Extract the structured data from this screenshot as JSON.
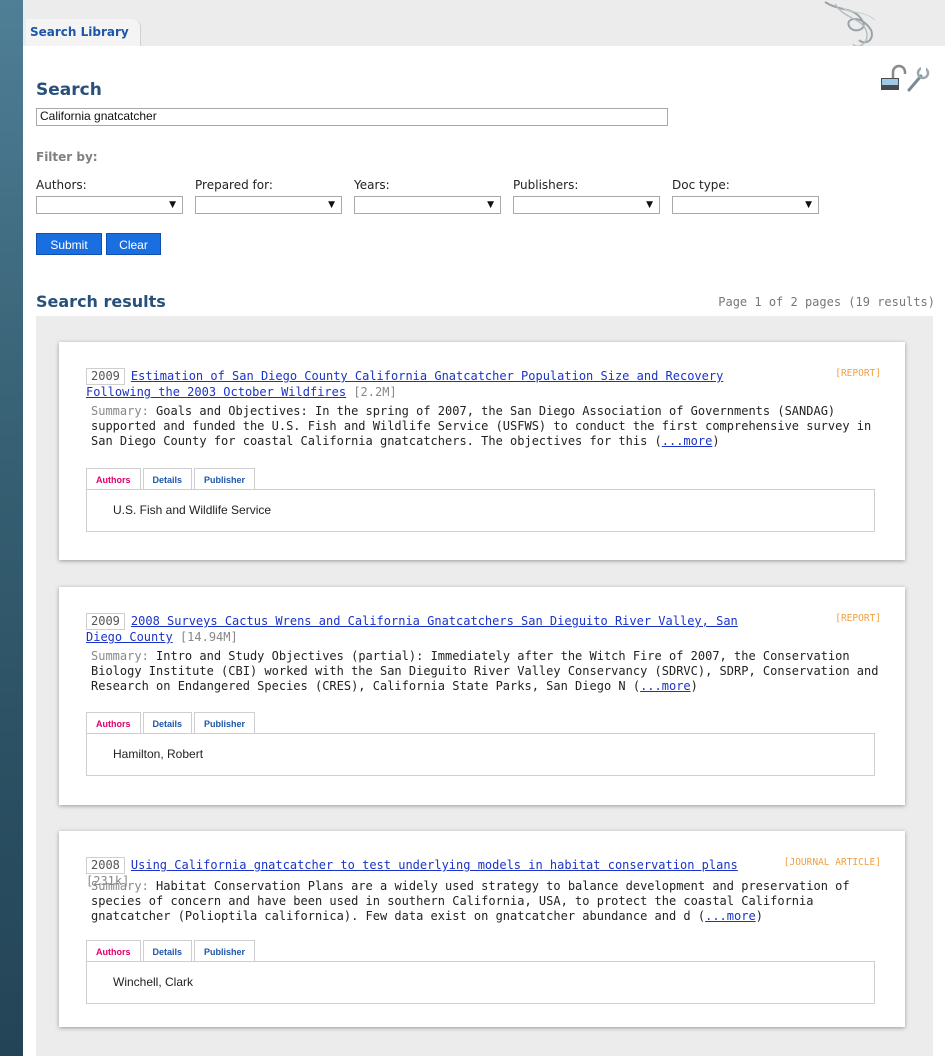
{
  "tabs": {
    "search_library": "Search Library"
  },
  "search": {
    "title": "Search",
    "query": "California gnatcatcher"
  },
  "filters": {
    "label": "Filter by:",
    "fields": [
      {
        "label": "Authors:",
        "value": ""
      },
      {
        "label": "Prepared for:",
        "value": ""
      },
      {
        "label": "Years:",
        "value": ""
      },
      {
        "label": "Publishers:",
        "value": ""
      },
      {
        "label": "Doc type:",
        "value": ""
      }
    ]
  },
  "buttons": {
    "submit": "Submit",
    "clear": "Clear"
  },
  "results": {
    "title": "Search results",
    "page_info": "Page 1 of 2 pages (19 results)",
    "items": [
      {
        "year": "2009",
        "title": "Estimation of San Diego County California Gnatcatcher Population Size and Recovery Following the 2003 October Wildfires",
        "size": "[2.2M]",
        "type": "[REPORT]",
        "summary_label": "Summary:",
        "summary": "Goals and Objectives: In the spring of 2007, the San Diego Association of Governments (SANDAG) supported and funded the U.S. Fish and Wildlife Service (USFWS) to conduct the first comprehensive survey in San Diego County for coastal California gnatcatchers. The objectives for this",
        "more": "...more",
        "tabs": [
          "Authors",
          "Details",
          "Publisher"
        ],
        "author": "U.S. Fish and Wildlife Service"
      },
      {
        "year": "2009",
        "title": "2008 Surveys Cactus Wrens and California Gnatcatchers San Dieguito River Valley, San Diego County",
        "size": "[14.94M]",
        "type": "[REPORT]",
        "summary_label": "Summary:",
        "summary": "Intro and Study Objectives (partial): Immediately after the Witch Fire of 2007, the Conservation Biology Institute (CBI) worked with the San Dieguito River Valley Conservancy (SDRVC), SDRP, Conservation and Research on Endangered Species (CRES), California State Parks, San Diego N",
        "more": "...more",
        "tabs": [
          "Authors",
          "Details",
          "Publisher"
        ],
        "author": "Hamilton, Robert"
      },
      {
        "year": "2008",
        "title": "Using California gnatcatcher to test underlying models in habitat conservation plans",
        "size": "[231k]",
        "type": "[JOURNAL ARTICLE]",
        "summary_label": "Summary:",
        "summary": "Habitat Conservation Plans are a widely used strategy to balance development and preservation of species of concern and have been used in southern California, USA, to protect the coastal California gnatcatcher (Polioptila californica). Few data exist on gnatcatcher abundance and d",
        "more": "...more",
        "tabs": [
          "Authors",
          "Details",
          "Publisher"
        ],
        "author": "Winchell, Clark"
      }
    ]
  },
  "icons": {
    "lock": "unlock-icon",
    "settings": "wrench-icon",
    "decoration": "tangle-decoration"
  }
}
